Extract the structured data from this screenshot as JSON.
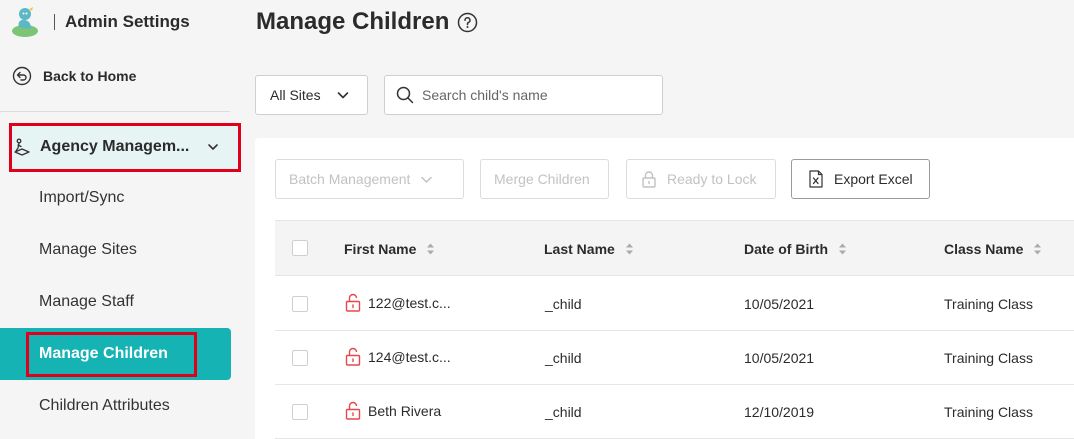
{
  "app": {
    "title": "Admin Settings",
    "back_label": "Back to Home"
  },
  "sidebar": {
    "group_label": "Agency Managem...",
    "items": [
      {
        "label": "Import/Sync"
      },
      {
        "label": "Manage Sites"
      },
      {
        "label": "Manage Staff"
      },
      {
        "label": "Manage Children"
      },
      {
        "label": "Children Attributes"
      }
    ],
    "active_item": "Manage Children"
  },
  "page": {
    "title": "Manage Children"
  },
  "filters": {
    "site_value": "All Sites",
    "search_placeholder": "Search child's name",
    "search_value": ""
  },
  "toolbar": {
    "batch_label": "Batch Management",
    "merge_label": "Merge Children",
    "lock_label": "Ready to Lock",
    "export_label": "Export Excel"
  },
  "table": {
    "columns": [
      "First Name",
      "Last Name",
      "Date of Birth",
      "Class Name"
    ],
    "rows": [
      {
        "first": "122@test.c...",
        "last": "_child",
        "dob": "10/05/2021",
        "class": "Training Class"
      },
      {
        "first": "124@test.c...",
        "last": "_child",
        "dob": "10/05/2021",
        "class": "Training Class"
      },
      {
        "first": "Beth Rivera",
        "last": "_child",
        "dob": "12/10/2019",
        "class": "Training Class"
      }
    ]
  },
  "colors": {
    "accent": "#16b3b5",
    "highlight_outline": "#e0001b",
    "unlock_icon": "#e5484d",
    "group_bg": "#e7f4f4"
  },
  "icons": {
    "logo": "brand-logo-icon",
    "back": "back-arrow-circle-icon",
    "agency": "agency-icon",
    "help": "help-circle-icon",
    "search": "search-icon",
    "unlock": "unlocked-lock-icon",
    "lock": "lock-icon",
    "excel": "excel-file-icon"
  }
}
